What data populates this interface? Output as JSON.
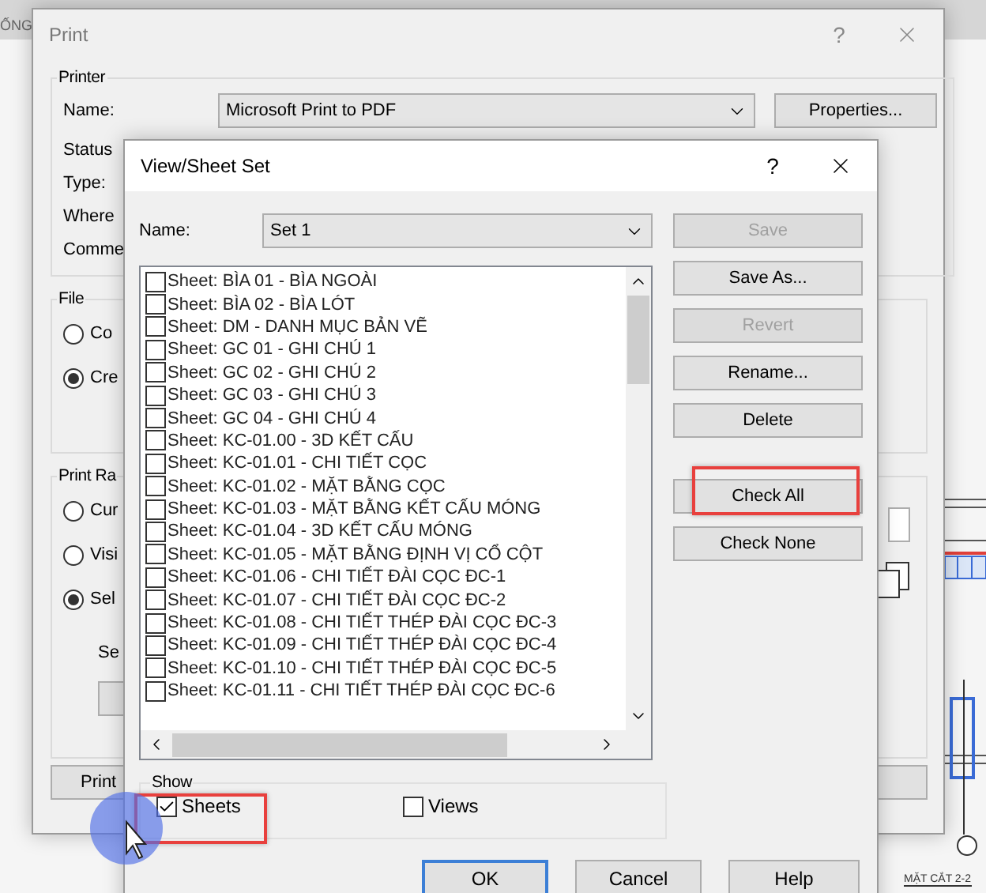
{
  "background": {
    "title_fragment": "ỐNG",
    "caption": "MẶT CẮT 2-2"
  },
  "print_dialog": {
    "title": "Print",
    "help": "?",
    "printer": {
      "label": "Printer",
      "name_label": "Name:",
      "name_value": "Microsoft Print to PDF",
      "properties_button": "Properties...",
      "fields": [
        "Status",
        "Type:",
        "Where",
        "Comme"
      ]
    },
    "file": {
      "label": "File",
      "options": [
        {
          "label": "Co",
          "selected": false
        },
        {
          "label": "Cre",
          "selected": true
        }
      ]
    },
    "print_range": {
      "label": "Print Ra",
      "options": [
        {
          "label": "Cur",
          "selected": false
        },
        {
          "label": "Visi",
          "selected": false
        },
        {
          "label": "Sel",
          "selected": true
        }
      ],
      "sub_label": "Se"
    },
    "print_button": "Print"
  },
  "sheet_dialog": {
    "title": "View/Sheet Set",
    "help": "?",
    "name_label": "Name:",
    "name_value": "Set 1",
    "items": [
      {
        "label": "Sheet: BÌA 01 - BÌA NGOÀI",
        "checked": false
      },
      {
        "label": "Sheet: BÌA 02 - BÌA LÓT",
        "checked": false
      },
      {
        "label": "Sheet: DM - DANH MỤC BẢN VẼ",
        "checked": false
      },
      {
        "label": "Sheet: GC 01 - GHI CHÚ 1",
        "checked": false
      },
      {
        "label": "Sheet: GC 02 - GHI CHÚ 2",
        "checked": false
      },
      {
        "label": "Sheet: GC 03 - GHI CHÚ 3",
        "checked": false
      },
      {
        "label": "Sheet: GC 04 - GHI CHÚ 4",
        "checked": false
      },
      {
        "label": "Sheet: KC-01.00 - 3D KẾT CẤU",
        "checked": false
      },
      {
        "label": "Sheet: KC-01.01 - CHI TIẾT CỌC",
        "checked": false
      },
      {
        "label": "Sheet: KC-01.02 - MẶT BẰNG CỌC",
        "checked": false
      },
      {
        "label": "Sheet: KC-01.03 - MẶT BẰNG KẾT CẤU MÓNG",
        "checked": false
      },
      {
        "label": "Sheet: KC-01.04 - 3D KẾT CẤU MÓNG",
        "checked": false
      },
      {
        "label": "Sheet: KC-01.05 - MẶT BẰNG ĐỊNH VỊ CỔ CỘT",
        "checked": false
      },
      {
        "label": "Sheet: KC-01.06 - CHI TIẾT ĐÀI CỌC ĐC-1",
        "checked": false
      },
      {
        "label": "Sheet: KC-01.07 - CHI TIẾT ĐÀI CỌC ĐC-2",
        "checked": false
      },
      {
        "label": "Sheet: KC-01.08 - CHI TIẾT THÉP ĐÀI CỌC ĐC-3",
        "checked": false
      },
      {
        "label": "Sheet: KC-01.09 - CHI TIẾT THÉP ĐÀI CỌC ĐC-4",
        "checked": false
      },
      {
        "label": "Sheet: KC-01.10 - CHI TIẾT THÉP ĐÀI CỌC ĐC-5",
        "checked": false
      },
      {
        "label": "Sheet: KC-01.11 - CHI TIẾT THÉP ĐÀI CỌC ĐC-6",
        "checked": false
      }
    ],
    "buttons": [
      {
        "label": "Save",
        "disabled": true,
        "highlighted": false
      },
      {
        "label": "Save As...",
        "disabled": false,
        "highlighted": false
      },
      {
        "label": "Revert",
        "disabled": true,
        "highlighted": false
      },
      {
        "label": "Rename...",
        "disabled": false,
        "highlighted": false
      },
      {
        "label": "Delete",
        "disabled": false,
        "highlighted": false
      }
    ],
    "check_buttons": [
      {
        "label": "Check All",
        "disabled": false,
        "highlighted": true
      },
      {
        "label": "Check None",
        "disabled": false,
        "highlighted": false
      }
    ],
    "show": {
      "label": "Show",
      "options": [
        {
          "label": "Sheets",
          "checked": true,
          "highlighted": true
        },
        {
          "label": "Views",
          "checked": false,
          "highlighted": false
        }
      ]
    },
    "footer_buttons": [
      {
        "label": "OK",
        "selected": true
      },
      {
        "label": "Cancel",
        "selected": false
      },
      {
        "label": "Help",
        "selected": false
      }
    ]
  }
}
